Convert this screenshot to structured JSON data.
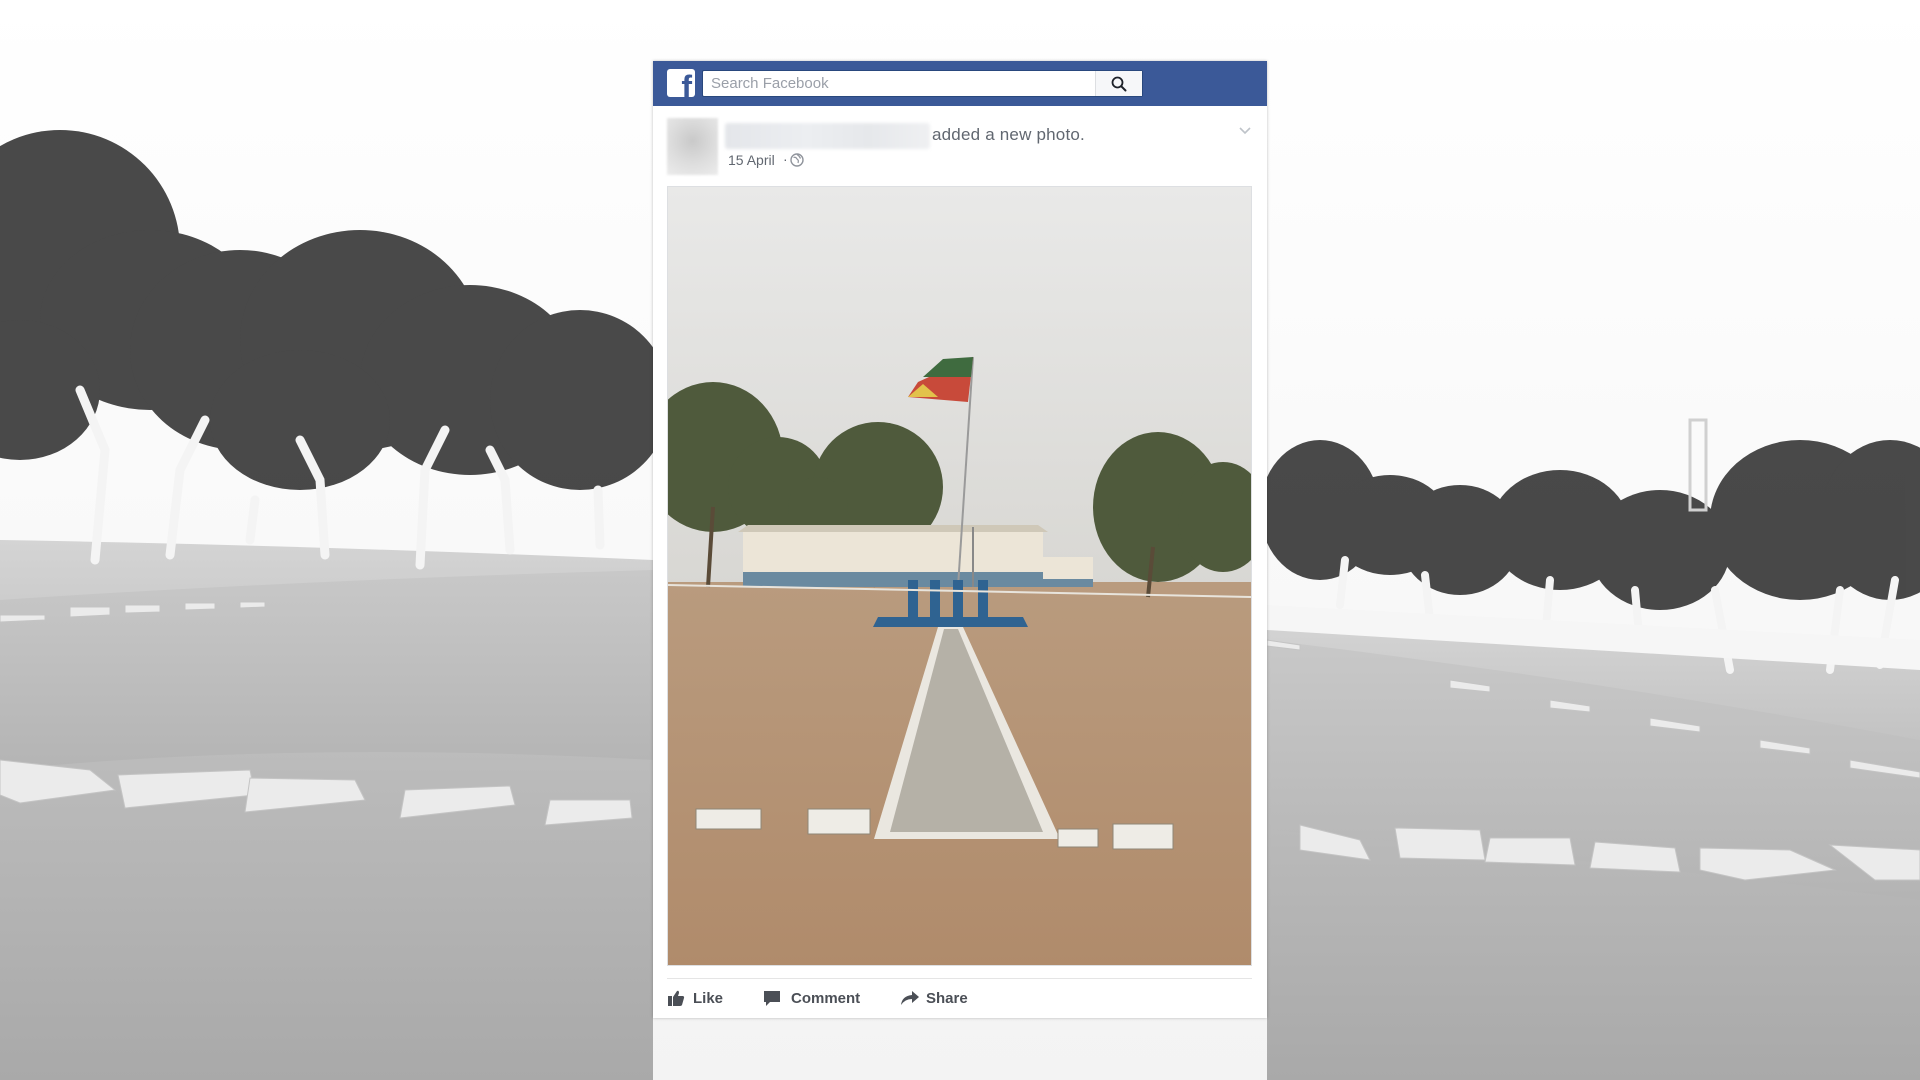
{
  "topbar": {
    "search_placeholder": "Search Facebook",
    "brand_color": "#3b5998"
  },
  "post": {
    "action_text": "added a new photo.",
    "date": "15 April",
    "separator": "·",
    "privacy_icon": "globe-icon",
    "menu_icon": "chevron-down-icon"
  },
  "actions": {
    "like": "Like",
    "comment": "Comment",
    "share": "Share"
  }
}
